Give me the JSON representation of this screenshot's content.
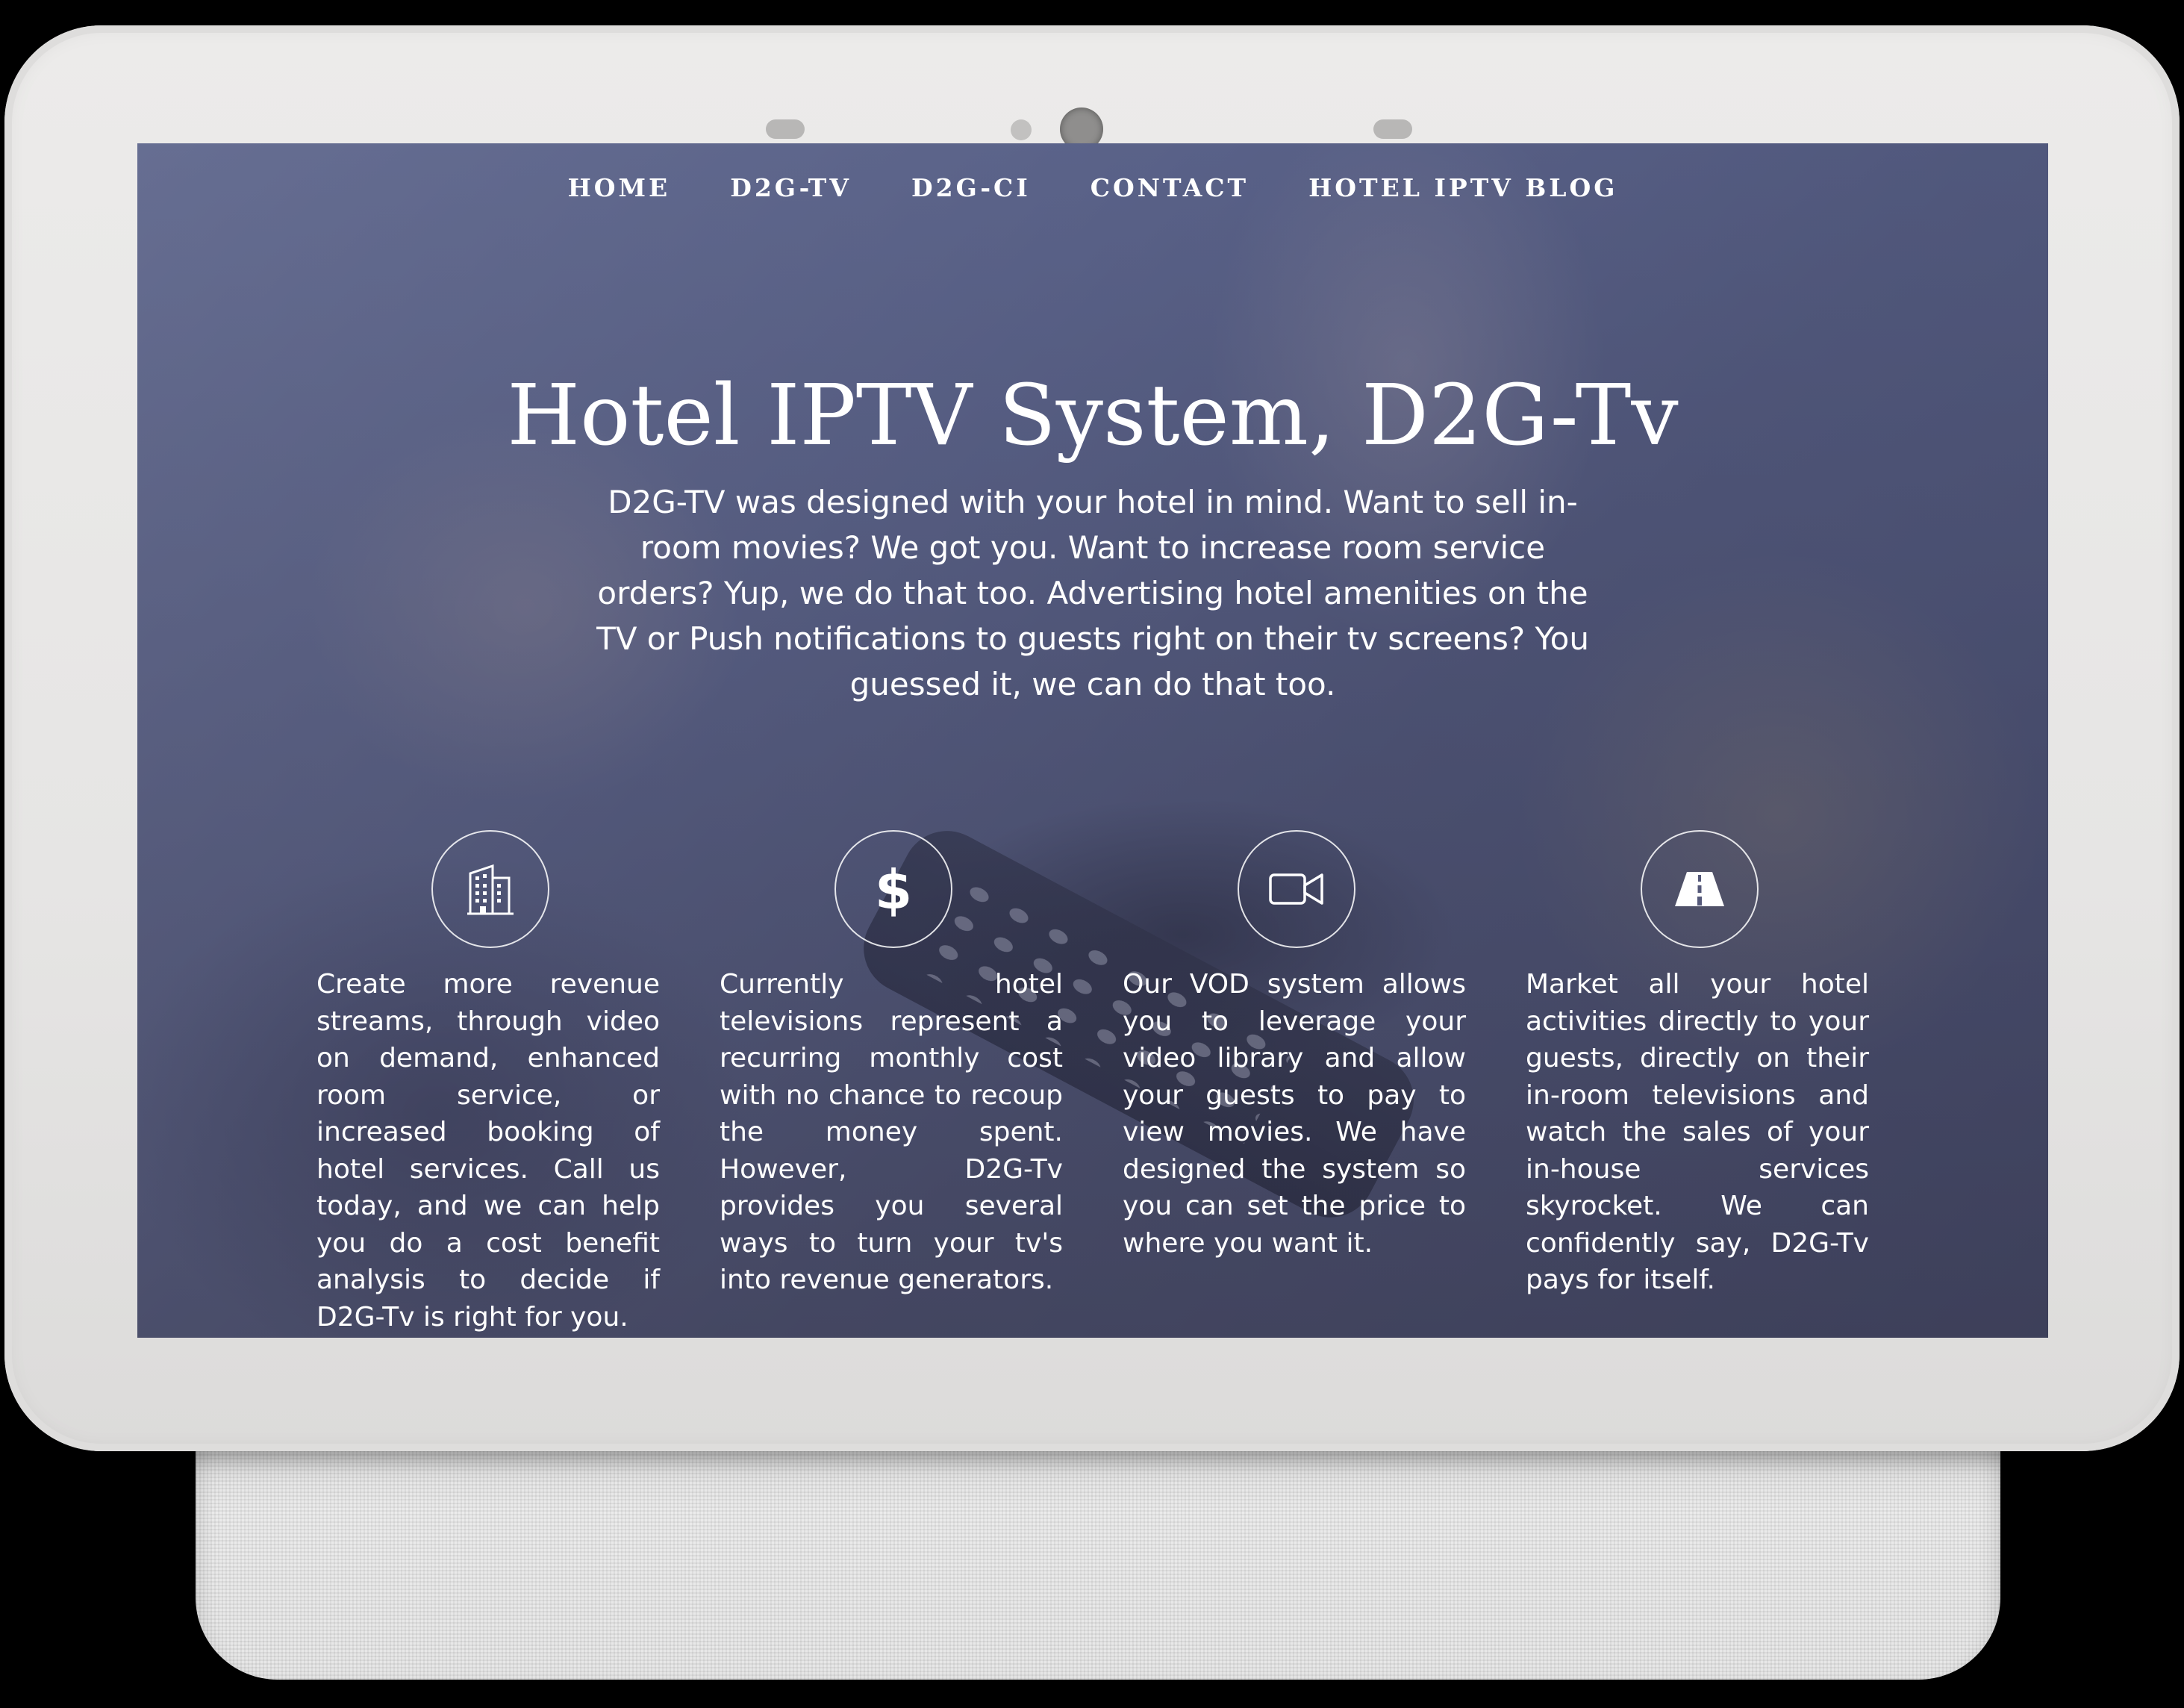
{
  "nav": {
    "items": [
      {
        "label": "HOME"
      },
      {
        "label": "D2G-TV"
      },
      {
        "label": "D2G-CI"
      },
      {
        "label": "CONTACT"
      },
      {
        "label": "HOTEL IPTV BLOG"
      }
    ]
  },
  "hero": {
    "title": "Hotel IPTV System, D2G-Tv",
    "text": "D2G-TV was designed with your hotel in mind. Want to sell in-room movies? We got you. Want to increase room service orders? Yup, we do that too. Advertising hotel amenities on the TV or Push notifications to guests right on their tv screens? You guessed it, we can do that too."
  },
  "features": [
    {
      "icon": "building-icon",
      "text": "Create more revenue streams, through video on demand, enhanced room service, or increased booking of hotel services. Call us today, and we can help you do a cost benefit analysis to decide if D2G-Tv is right for you."
    },
    {
      "icon": "dollar-icon",
      "text": "Currently hotel televisions represent a recurring monthly cost with no chance to recoup the money spent. However, D2G-Tv provides you several ways to turn your tv's into revenue generators."
    },
    {
      "icon": "video-camera-icon",
      "text": "Our VOD system allows you to leverage your video library and allow your guests to pay to view movies. We have designed the system so you can set the price to where you want it."
    },
    {
      "icon": "road-icon",
      "text": "Market all your hotel activities directly to your guests, directly on their in-room televisions and watch the sales of your in-house services skyrocket. We can confidently say, D2G-Tv pays for itself."
    }
  ]
}
